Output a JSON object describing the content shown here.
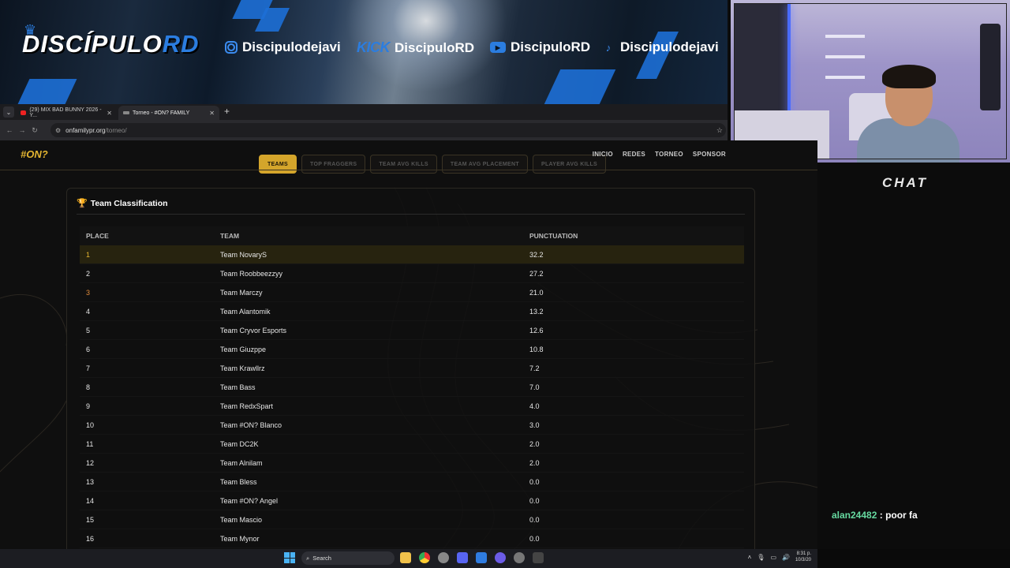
{
  "banner": {
    "logo_main": "DISCÍPULO",
    "logo_accent": "RD",
    "socials": [
      {
        "icon": "instagram-icon",
        "handle": "Discipulodejavi"
      },
      {
        "icon": "kick-logo",
        "label": "KICK",
        "handle": "DiscipuloRD"
      },
      {
        "icon": "youtube-icon",
        "handle": "DiscipuloRD"
      },
      {
        "icon": "tiktok-icon",
        "handle": "Discipulodejavi"
      }
    ],
    "accent_color": "#2b7de0"
  },
  "browser": {
    "tabs": [
      {
        "label": "(29) MIX BAD BUNNY 2026 - Y...",
        "icon": "youtube-favicon"
      },
      {
        "label": "Torneo - #ON? FAMILY",
        "icon": "site-favicon",
        "active": true
      }
    ],
    "new_tab": "+",
    "url_domain": "onfamilypr.org",
    "url_path": "/torneo/"
  },
  "site": {
    "logo": "#ON?",
    "nav": [
      "INICIO",
      "REDES",
      "TORNEO",
      "SPONSOR"
    ],
    "ranking_tabs": [
      {
        "label": "TEAMS",
        "active": true
      },
      {
        "label": "TOP FRAGGERS"
      },
      {
        "label": "TEAM AVG KILLS"
      },
      {
        "label": "TEAM AVG PLACEMENT"
      },
      {
        "label": "PLAYER AVG KILLS"
      }
    ],
    "accent_color": "#d4a52b"
  },
  "classification": {
    "title": "Team Classification",
    "headers": [
      "PLACE",
      "TEAM",
      "PUNCTUATION"
    ],
    "rows": [
      {
        "place": "1",
        "team": "Team NovaryS",
        "points": "32.2"
      },
      {
        "place": "2",
        "team": "Team Roobbeezzyy",
        "points": "27.2"
      },
      {
        "place": "3",
        "team": "Team Marczy",
        "points": "21.0"
      },
      {
        "place": "4",
        "team": "Team Alantomik",
        "points": "13.2"
      },
      {
        "place": "5",
        "team": "Team Cryvor Esports",
        "points": "12.6"
      },
      {
        "place": "6",
        "team": "Team Giuzppe",
        "points": "10.8"
      },
      {
        "place": "7",
        "team": "Team Krawllrz",
        "points": "7.2"
      },
      {
        "place": "8",
        "team": "Team Bass",
        "points": "7.0"
      },
      {
        "place": "9",
        "team": "Team RedxSpart",
        "points": "4.0"
      },
      {
        "place": "10",
        "team": "Team #ON? Blanco",
        "points": "3.0"
      },
      {
        "place": "11",
        "team": "Team DC2K",
        "points": "2.0"
      },
      {
        "place": "12",
        "team": "Team Alnilam",
        "points": "2.0"
      },
      {
        "place": "13",
        "team": "Team Bless",
        "points": "0.0"
      },
      {
        "place": "14",
        "team": "Team #ON? Angel",
        "points": "0.0"
      },
      {
        "place": "15",
        "team": "Team Mascio",
        "points": "0.0"
      },
      {
        "place": "16",
        "team": "Team Mynor",
        "points": "0.0"
      }
    ]
  },
  "chat": {
    "title": "CHAT",
    "message_user": "alan24482",
    "message_text": ": poor fa"
  },
  "taskbar": {
    "search_placeholder": "Search",
    "time": "8:31 p.",
    "date": "10/3/20"
  }
}
